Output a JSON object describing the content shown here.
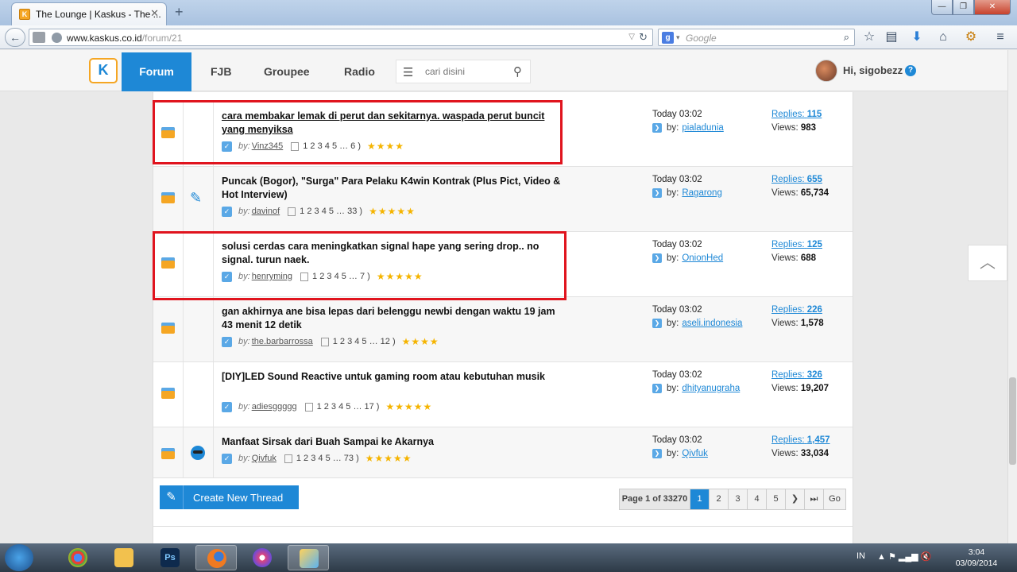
{
  "browser": {
    "tab_title": "The Lounge | Kaskus - The ...",
    "tab_close": "✕",
    "new_tab": "+",
    "url_host": "www.kaskus.co.id",
    "url_path": "/forum/21",
    "search_placeholder": "Google",
    "window_min": "—",
    "window_max": "❐",
    "window_close": "✕"
  },
  "site": {
    "nav": {
      "forum": "Forum",
      "fjb": "FJB",
      "groupee": "Groupee",
      "radio": "Radio"
    },
    "search_placeholder": "cari disini",
    "greeting": "Hi, sigobezz",
    "help": "?"
  },
  "threads": [
    {
      "title": "cara membakar lemak di perut dan sekitarnya. waspada perut buncit yang menyiksa",
      "author": "Vinz345",
      "pages": "1  2  3  4  5 … 6 )",
      "stars": "★★★★",
      "last_time": "Today 03:02",
      "last_user": "pialadunia",
      "replies": "115",
      "views": "983"
    },
    {
      "title": "Puncak (Bogor), \"Surga\" Para Pelaku K4win Kontrak (Plus Pict, Video & Hot Interview)",
      "author": "davinof",
      "pages": "1  2  3  4  5 … 33 )",
      "stars": "★★★★★",
      "last_time": "Today 03:02",
      "last_user": "Ragarong",
      "replies": "655",
      "views": "65,734"
    },
    {
      "title": "solusi cerdas cara meningkatkan signal hape yang sering drop.. no signal. turun naek.",
      "author": "henryming",
      "pages": "1  2  3  4  5 … 7 )",
      "stars": "★★★★★",
      "last_time": "Today 03:02",
      "last_user": "OnionHed",
      "replies": "125",
      "views": "688"
    },
    {
      "title": "gan akhirnya ane bisa lepas dari belenggu newbi dengan waktu 19 jam 43 menit 12 detik",
      "author": "the.barbarrossa",
      "pages": "1  2  3  4  5 … 12 )",
      "stars": "★★★★",
      "last_time": "Today 03:02",
      "last_user": "aseli.indonesia",
      "replies": "226",
      "views": "1,578"
    },
    {
      "title": "[DIY]LED Sound Reactive untuk gaming room atau kebutuhan musik",
      "author": "adiesggggg",
      "pages": "1  2  3  4  5 … 17 )",
      "stars": "★★★★★",
      "last_time": "Today 03:02",
      "last_user": "dhityanugraha",
      "replies": "326",
      "views": "19,207"
    },
    {
      "title": "Manfaat Sirsak dari Buah Sampai ke Akarnya",
      "author": "Qivfuk",
      "pages": "1  2  3  4  5 … 73 )",
      "stars": "★★★★★",
      "last_time": "Today 03:02",
      "last_user": "Qivfuk",
      "replies": "1,457",
      "views": "33,034"
    }
  ],
  "labels": {
    "by": "by:",
    "last_by": "by:",
    "replies": "Replies:",
    "views": "Views:"
  },
  "create_thread": "Create New Thread",
  "pagination": {
    "info": "Page 1 of 33270",
    "pages": [
      "1",
      "2",
      "3",
      "4",
      "5"
    ],
    "next": "❯",
    "last": "⏭",
    "go": "Go"
  },
  "taskbar": {
    "lang": "IN",
    "time": "3:04",
    "date": "03/09/2014"
  },
  "colors": {
    "accent": "#1e88d6",
    "highlight": "#e0141e",
    "star": "#f5b400"
  }
}
